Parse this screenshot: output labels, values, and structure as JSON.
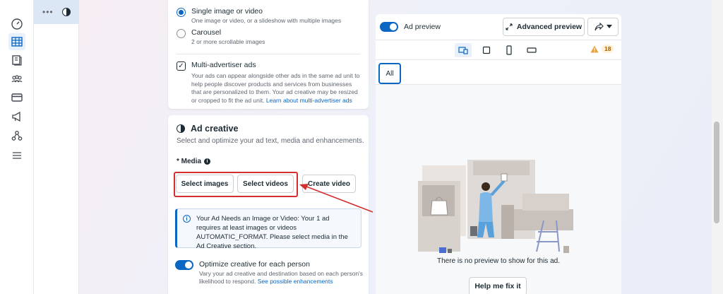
{
  "rail": {
    "items": [
      {
        "icon": "gauge-icon"
      },
      {
        "icon": "table-grid-icon",
        "active": true
      },
      {
        "icon": "campaigns-icon"
      },
      {
        "icon": "audiences-icon"
      },
      {
        "icon": "billing-card-icon"
      },
      {
        "icon": "megaphone-icon"
      },
      {
        "icon": "graph-icon"
      },
      {
        "icon": "menu-icon"
      }
    ]
  },
  "nav": {
    "more": "•••"
  },
  "format": {
    "single": {
      "title": "Single image or video",
      "desc": "One image or video, or a slideshow with multiple images",
      "selected": true
    },
    "carousel": {
      "title": "Carousel",
      "desc": "2 or more scrollable images",
      "selected": false
    }
  },
  "multi_advertiser": {
    "title": "Multi-advertiser ads",
    "checked": true,
    "desc": "Your ads can appear alongside other ads in the same ad unit to help people discover products and services from businesses that are personalized to them. Your ad creative may be resized or cropped to fit the ad unit.",
    "link": "Learn about multi-advertiser ads"
  },
  "creative": {
    "title": "Ad creative",
    "subtitle": "Select and optimize your ad text, media and enhancements.",
    "media_label": "* Media",
    "buttons": {
      "select_images": "Select images",
      "select_videos": "Select videos",
      "create_video": "Create video"
    },
    "info": "Your Ad Needs an Image or Video: Your 1 ad requires at least images or videos AUTOMATIC_FORMAT. Please select media in the Ad Creative section.",
    "optimize": {
      "title": "Optimize creative for each person",
      "desc": "Vary your ad creative and destination based on each person's likelihood to respond.",
      "link": "See possible enhancements",
      "enabled": true
    }
  },
  "preview": {
    "toggle_label": "Ad preview",
    "toggle_on": true,
    "advanced_label": "Advanced preview",
    "warning_count": "18",
    "filter_all": "All",
    "empty_text": "There is no preview to show for this ad.",
    "fix_button": "Help me fix it"
  },
  "colors": {
    "accent": "#0a66c2",
    "annotation": "#d32f2f",
    "warning": "#e8a13a"
  }
}
